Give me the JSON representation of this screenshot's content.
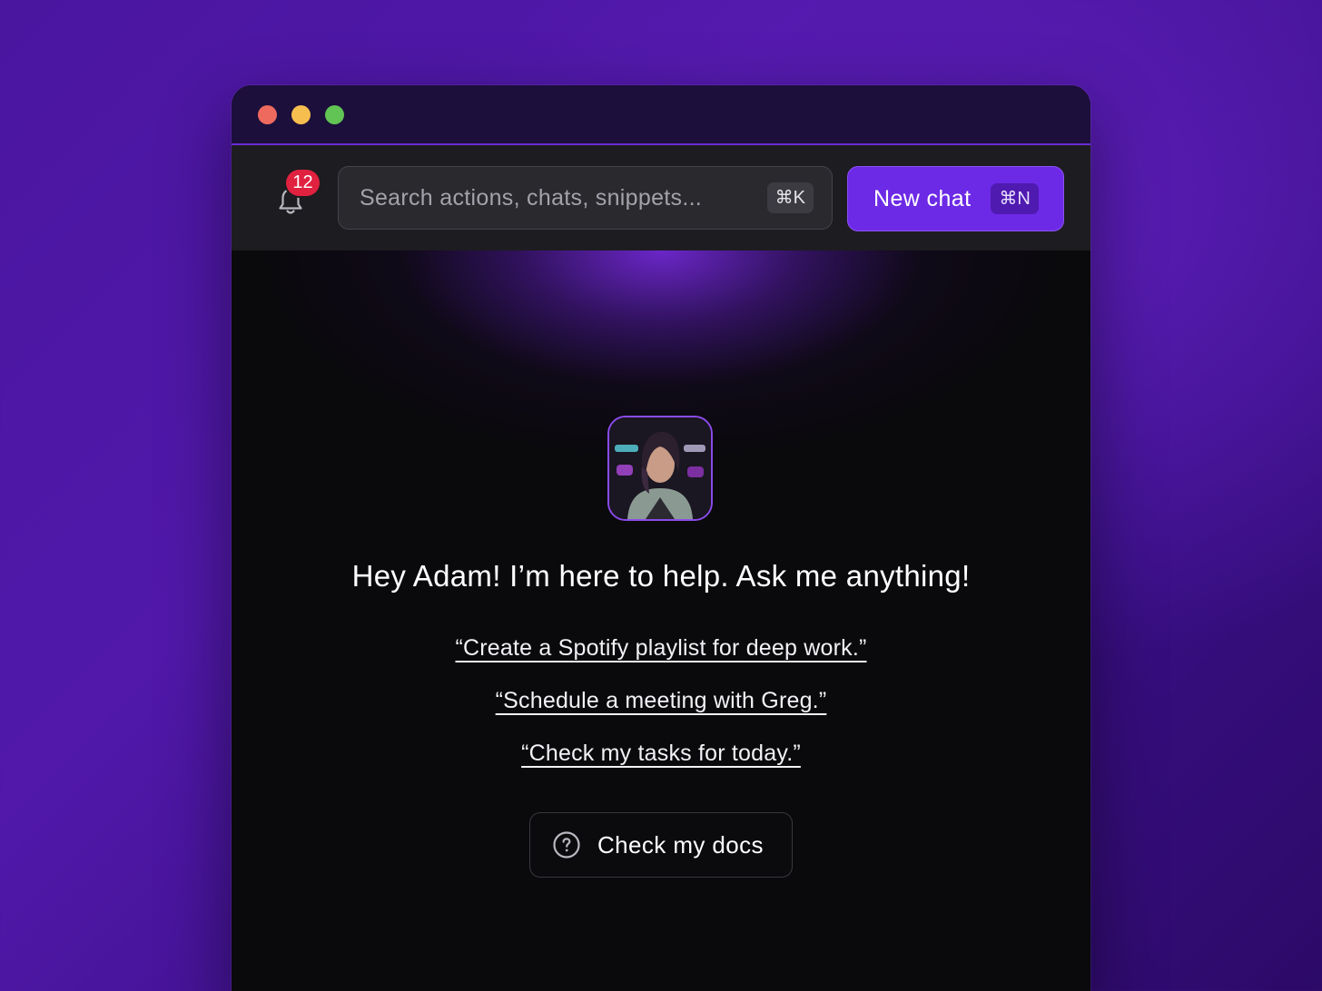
{
  "toolbar": {
    "notification_count": "12",
    "search_placeholder": "Search actions, chats, snippets...",
    "search_shortcut": "⌘K",
    "new_chat_label": "New chat",
    "new_chat_shortcut": "⌘N"
  },
  "main": {
    "headline": "Hey Adam! I’m here to help. Ask me anything!",
    "suggestions": [
      "“Create a Spotify playlist for deep work.”",
      "“Schedule a meeting with Greg.”",
      "“Check my tasks for today.”"
    ],
    "docs_button_label": "Check my docs"
  },
  "icons": {
    "notifications": "bell-icon",
    "help": "question-circle-icon",
    "window_controls": [
      "close-dot",
      "minimize-dot",
      "zoom-dot"
    ]
  },
  "colors": {
    "accent": "#6d2ae6",
    "badge": "#e0213f",
    "window_close": "#ee6a5e",
    "window_minimize": "#f6be4f",
    "window_zoom": "#61c454"
  }
}
